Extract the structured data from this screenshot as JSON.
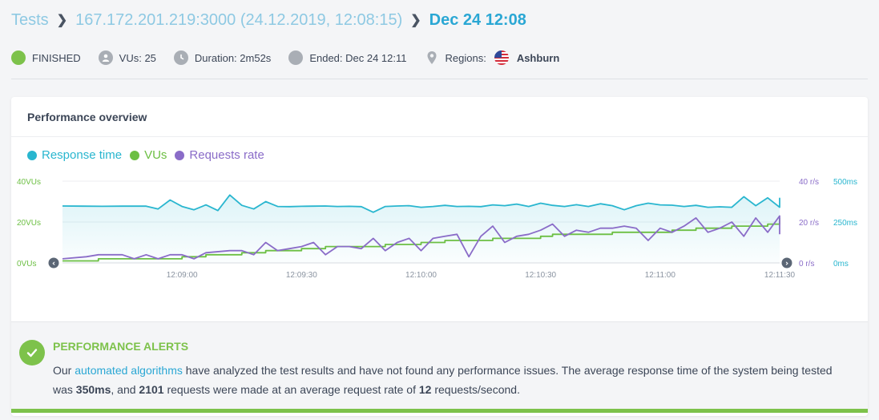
{
  "breadcrumb": {
    "root": "Tests",
    "test": "167.172.201.219:3000 (24.12.2019, 12:08:15)",
    "current": "Dec 24 12:08"
  },
  "status": {
    "state": "FINISHED",
    "vus": "VUs: 25",
    "duration": "Duration: 2m52s",
    "ended": "Ended: Dec 24 12:11",
    "regions_label": "Regions:",
    "region": "Ashburn"
  },
  "card": {
    "title": "Performance overview"
  },
  "legend": {
    "response_time": "Response time",
    "vus": "VUs",
    "requests_rate": "Requests rate"
  },
  "colors": {
    "response_time": "#29b6cf",
    "vus": "#6cbf43",
    "requests_rate": "#8a6cc8",
    "accent": "#2aa7d4",
    "success": "#7dc24b"
  },
  "chart_data": {
    "type": "line",
    "x_ticks": [
      "12:09:00",
      "12:09:30",
      "12:10:00",
      "12:10:30",
      "12:11:00",
      "12:11:30"
    ],
    "x_tick_seconds": [
      45,
      75,
      105,
      135,
      165,
      195
    ],
    "x_range_seconds": [
      15,
      195
    ],
    "left_axis": {
      "ticks": [
        "0VUs",
        "20VUs",
        "40VUs"
      ],
      "range": [
        0,
        40
      ]
    },
    "right_axis_rate": {
      "ticks": [
        "0 r/s",
        "20 r/s",
        "40 r/s"
      ],
      "range": [
        0,
        40
      ]
    },
    "right_axis_time": {
      "ticks": [
        "0ms",
        "250ms",
        "500ms"
      ],
      "range": [
        0,
        500
      ]
    },
    "series": [
      {
        "name": "Response time",
        "axis": "ms",
        "t": [
          15,
          20,
          25,
          30,
          33,
          36,
          39,
          42,
          45,
          48,
          51,
          54,
          57,
          60,
          63,
          66,
          69,
          72,
          75,
          78,
          81,
          84,
          87,
          90,
          93,
          96,
          99,
          102,
          105,
          108,
          111,
          114,
          117,
          120,
          123,
          126,
          129,
          132,
          135,
          138,
          141,
          144,
          147,
          150,
          153,
          156,
          159,
          162,
          165,
          168,
          171,
          174,
          177,
          180,
          183,
          186,
          189,
          192,
          195,
          198,
          201,
          204,
          207,
          210,
          213,
          216,
          219
        ],
        "values": [
          348,
          347,
          346,
          347,
          347,
          347,
          330,
          385,
          345,
          325,
          355,
          320,
          415,
          352,
          330,
          375,
          345,
          344,
          346,
          347,
          348,
          345,
          346,
          344,
          310,
          345,
          348,
          350,
          340,
          345,
          352,
          345,
          346,
          344,
          355,
          350,
          360,
          345,
          365,
          352,
          345,
          356,
          345,
          362,
          350,
          325,
          350,
          365,
          355,
          353,
          345,
          352,
          340,
          343,
          340,
          405,
          350,
          398,
          340,
          350,
          370,
          345,
          385,
          340,
          395,
          375,
          353
        ]
      },
      {
        "name": "VUs",
        "axis": "vus",
        "t": [
          15,
          24,
          24,
          45,
          45,
          51,
          51,
          60,
          60,
          66,
          66,
          75,
          75,
          81,
          81,
          96,
          96,
          105,
          105,
          111,
          111,
          123,
          123,
          135,
          135,
          138,
          138,
          153,
          153,
          168,
          168,
          174,
          174,
          183,
          183,
          192,
          192,
          198,
          198,
          207,
          207,
          216,
          216,
          220
        ],
        "values": [
          1,
          1,
          2,
          2,
          3,
          3,
          4,
          4,
          5,
          5,
          6,
          6,
          7,
          7,
          8,
          8,
          9,
          9,
          10,
          10,
          11,
          11,
          12,
          12,
          13,
          13,
          14,
          14,
          15,
          15,
          16,
          16,
          17,
          17,
          18,
          18,
          19,
          19,
          20,
          20,
          21,
          21,
          22,
          22
        ]
      },
      {
        "name": "Requests rate",
        "axis": "rate",
        "t": [
          15,
          21,
          24,
          30,
          33,
          36,
          39,
          42,
          45,
          48,
          51,
          57,
          60,
          63,
          66,
          69,
          72,
          75,
          78,
          81,
          84,
          87,
          90,
          93,
          96,
          99,
          102,
          105,
          108,
          111,
          114,
          117,
          120,
          123,
          126,
          129,
          132,
          135,
          138,
          141,
          144,
          147,
          150,
          153,
          156,
          159,
          162,
          165,
          168,
          171,
          174,
          177,
          180,
          183,
          186,
          189,
          192,
          195,
          198,
          201,
          204,
          207,
          210,
          213,
          216,
          219
        ],
        "values": [
          2,
          3,
          4,
          4,
          2,
          4,
          2,
          4,
          4,
          2,
          5,
          6,
          6,
          4,
          10,
          6,
          7,
          8,
          10,
          4,
          8,
          8,
          7,
          12,
          6,
          10,
          12,
          6,
          12,
          13,
          14,
          3,
          13,
          18,
          10,
          13,
          14,
          16,
          19,
          13,
          16,
          15,
          17,
          17,
          18,
          17,
          11,
          17,
          15,
          18,
          22,
          15,
          17,
          20,
          13,
          22,
          15,
          23,
          16,
          22,
          17,
          21,
          21,
          21,
          18,
          14
        ]
      }
    ]
  },
  "alerts": {
    "title": "PERFORMANCE ALERTS",
    "text_before_link": "Our ",
    "link": "automated algorithms",
    "text_after_link": " have analyzed the test results and have not found any performance issues. The average response time of the system being tested was ",
    "avg_response": "350ms",
    "text_mid": ", and ",
    "requests": "2101",
    "text_mid2": " requests were made at an average request rate of ",
    "rate": "12",
    "text_end": " requests/second."
  }
}
